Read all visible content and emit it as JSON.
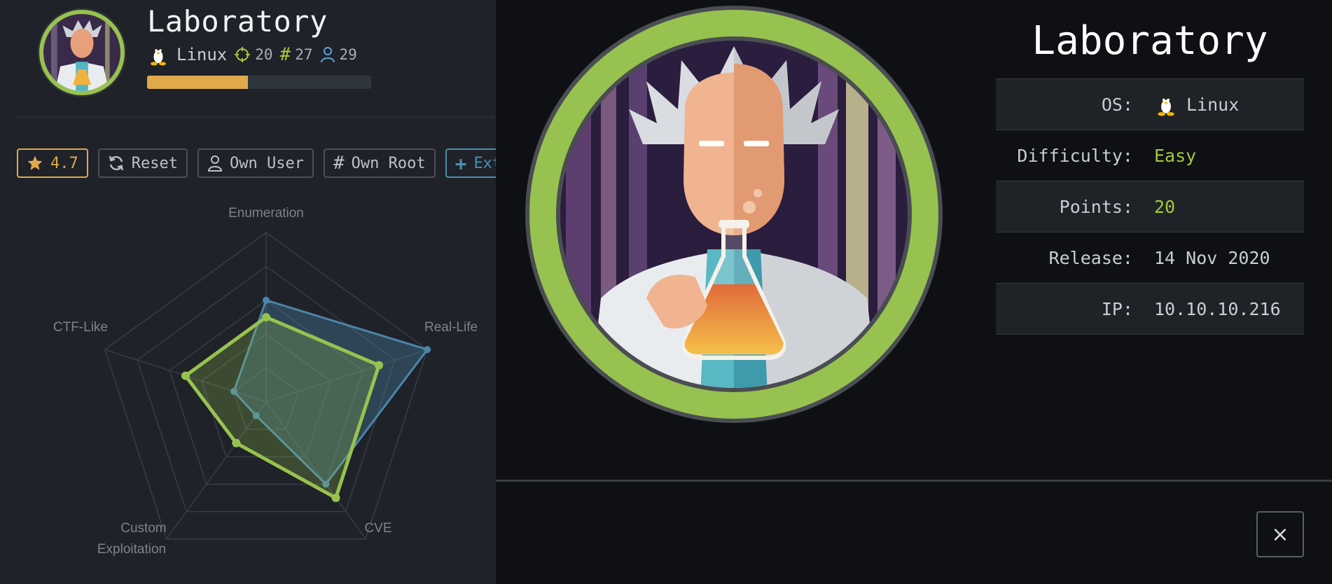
{
  "machine": {
    "name": "Laboratory",
    "os": "Linux",
    "icon": "tux-penguin-icon"
  },
  "header_stats": {
    "points": "20",
    "root_owns": "27",
    "user_owns": "29",
    "progress_percent": 45
  },
  "buttons": {
    "rating": "4.7",
    "reset": "Reset",
    "own_user": "Own User",
    "own_root": "Own Root",
    "extend": "Exten"
  },
  "radar": {
    "axes": [
      "Enumeration",
      "Real-Life",
      "CVE",
      "Custom",
      "Exploitation",
      "CTF-Like"
    ],
    "labels": {
      "enumeration": "Enumeration",
      "real_life": "Real-Life",
      "cve": "CVE",
      "custom_line1": "Custom",
      "custom_line2": "Exploitation",
      "ctf_like": "CTF-Like"
    }
  },
  "chart_data": {
    "type": "radar",
    "categories": [
      "Enumeration",
      "Real-Life",
      "CVE",
      "Custom Exploitation",
      "CTF-Like"
    ],
    "series": [
      {
        "values": [
          6,
          10,
          6,
          1,
          2
        ],
        "color": "#4a86a8"
      },
      {
        "values": [
          5,
          7,
          7,
          3,
          5
        ],
        "color": "#97c24f"
      }
    ],
    "ylim": [
      0,
      10
    ],
    "grid": true
  },
  "info": {
    "os_label": "OS:",
    "os_value": "Linux",
    "difficulty_label": "Difficulty:",
    "difficulty_value": "Easy",
    "points_label": "Points:",
    "points_value": "20",
    "release_label": "Release:",
    "release_value": "14 Nov 2020",
    "ip_label": "IP:",
    "ip_value": "10.10.10.216"
  },
  "modal": {
    "close_label": "×"
  },
  "colors": {
    "accent_green": "#97c24f",
    "accent_orange": "#e0a94a",
    "accent_blue": "#4a86a8"
  }
}
